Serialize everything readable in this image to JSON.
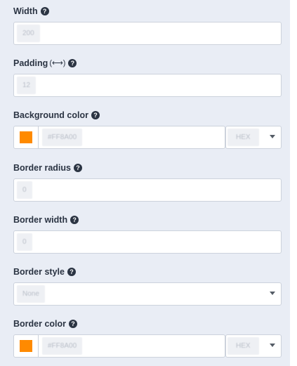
{
  "fields": {
    "width": {
      "label": "Width",
      "value": "200"
    },
    "padding": {
      "label": "Padding",
      "arrows": "(⟷)",
      "value": "12"
    },
    "background_color": {
      "label": "Background color",
      "value": "#FF8A00",
      "format": "HEX",
      "swatch": "#ff8a00"
    },
    "border_radius": {
      "label": "Border radius",
      "value": "0"
    },
    "border_width": {
      "label": "Border width",
      "value": "0"
    },
    "border_style": {
      "label": "Border style",
      "value": "None"
    },
    "border_color": {
      "label": "Border color",
      "value": "#FF8A00",
      "format": "HEX",
      "swatch": "#ff8a00"
    }
  },
  "help_glyph": "?",
  "icons": {
    "help": "question-circle-icon",
    "dropdown": "chevron-down-icon"
  }
}
